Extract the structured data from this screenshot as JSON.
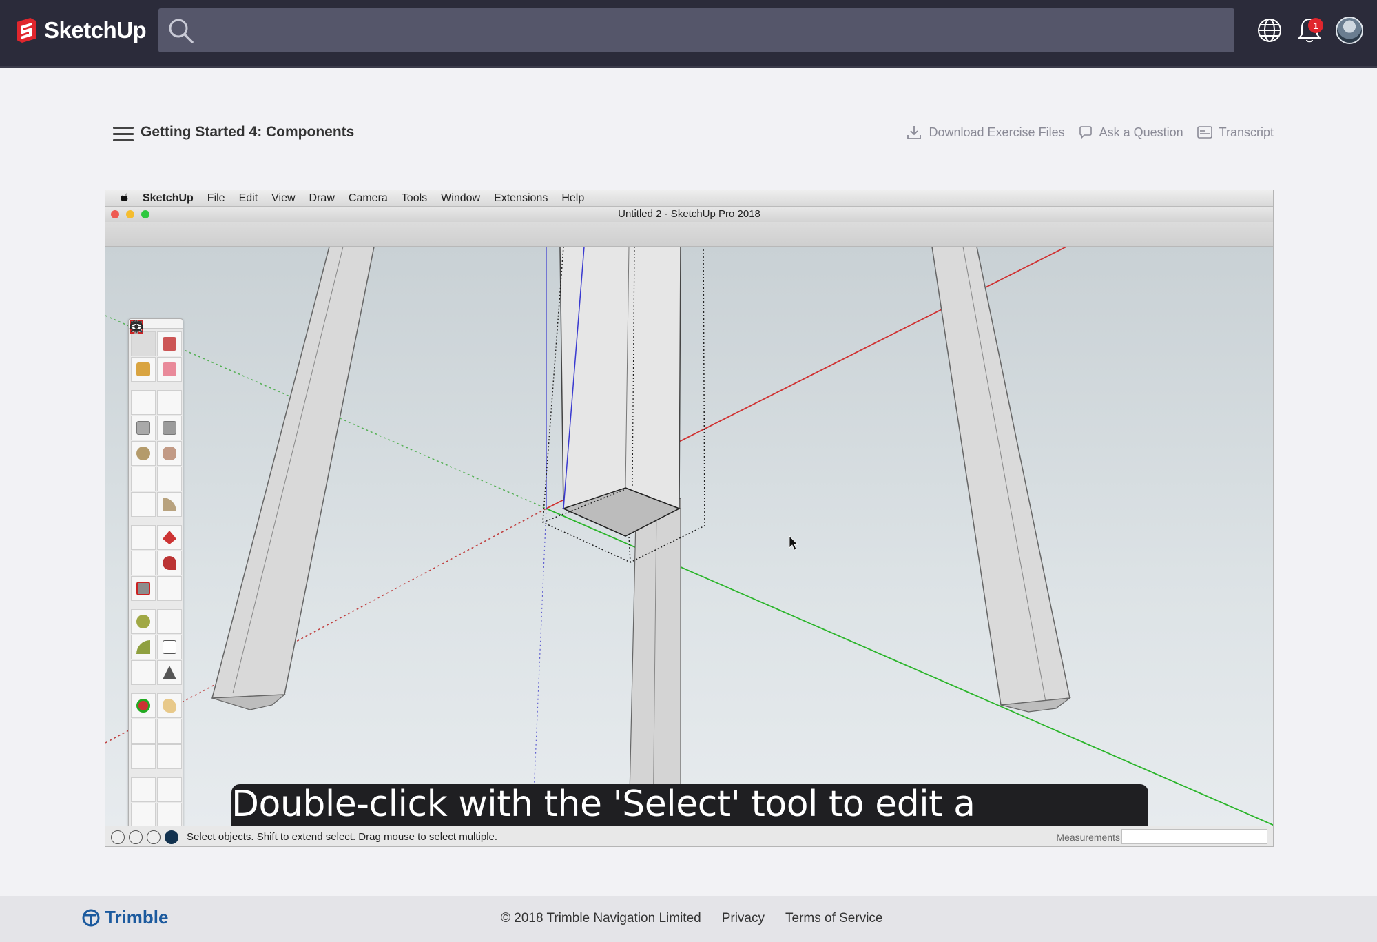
{
  "header": {
    "brand": "SketchUp",
    "search_placeholder": "",
    "notification_count": "1"
  },
  "lesson": {
    "title": "Getting Started 4: Components",
    "actions": {
      "download": "Download Exercise Files",
      "ask": "Ask a Question",
      "transcript": "Transcript"
    }
  },
  "video": {
    "mac_menu": [
      "SketchUp",
      "File",
      "Edit",
      "View",
      "Draw",
      "Camera",
      "Tools",
      "Window",
      "Extensions",
      "Help"
    ],
    "window_title": "Untitled 2 - SketchUp Pro 2018",
    "caption": "Double-click with the 'Select' tool to edit a component.",
    "status_text": "Select objects. Shift to extend select. Drag mouse to select multiple.",
    "measurements_label": "Measurements",
    "measurements_value": ""
  },
  "footer": {
    "brand": "Trimble",
    "copyright": "© 2018 Trimble Navigation Limited",
    "privacy": "Privacy",
    "terms": "Terms of Service"
  },
  "colors": {
    "topbar": "#2b2b3a",
    "search": "#55566a",
    "brand_red": "#e0262d",
    "trimble_blue": "#1c5a9e",
    "caption_bg": "#1f1f22"
  },
  "icons": [
    "sketchup-logo-icon",
    "search-icon",
    "globe-icon",
    "bell-icon",
    "avatar",
    "menu-icon",
    "download-icon",
    "chat-icon",
    "transcript-icon",
    "apple-icon",
    "trimble-logo-icon"
  ]
}
